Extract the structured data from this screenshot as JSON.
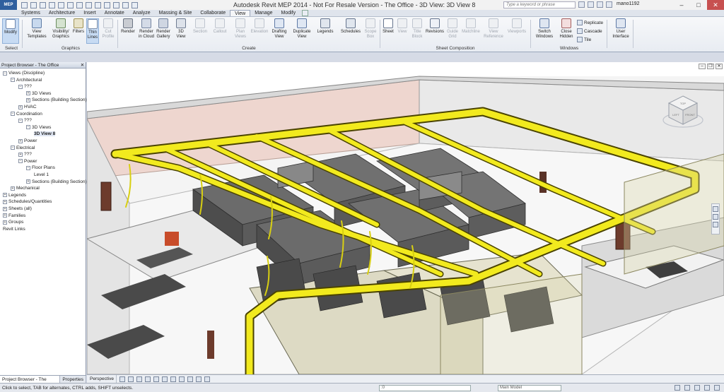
{
  "app": {
    "title": "Autodesk Revit MEP 2014 -  Not For Resale Version -   The Office - 3D View: 3D View 8",
    "app_button": "MEP",
    "search_placeholder": "Type a keyword or phrase",
    "user": "mano1192"
  },
  "tabs": [
    "Systems",
    "Architecture",
    "Insert",
    "Annotate",
    "Analyze",
    "Massing & Site",
    "Collaborate",
    "View",
    "Manage",
    "Modify"
  ],
  "active_tab": "View",
  "ribbon": {
    "modify": "Modify",
    "select_panel": "Select",
    "graphics": {
      "label": "Graphics",
      "view_templates": "View\nTemplates",
      "visibility_graphics": "Visibility/\nGraphics",
      "filters": "Filters",
      "thin_lines": "Thin\nLines",
      "cut_profile": "Cut\nProfile"
    },
    "create": {
      "label": "Create",
      "render": "Render",
      "render_cloud": "Render\nin Cloud",
      "render_gallery": "Render\nGallery",
      "view_3d": "3D\nView",
      "section": "Section",
      "callout": "Callout",
      "plan_views": "Plan\nViews",
      "elevation": "Elevation",
      "drafting_view": "Drafting\nView",
      "duplicate_view": "Duplicate\nView",
      "legends": "Legends",
      "schedules": "Schedules",
      "scope_box": "Scope\nBox"
    },
    "sheet_composition": {
      "label": "Sheet Composition",
      "sheet": "Sheet",
      "view": "View",
      "title_block": "Title\nBlock",
      "revisions": "Revisions",
      "guide_grid": "Guide\nGrid",
      "matchline": "Matchline",
      "view_reference": "View\nReference",
      "viewports": "Viewports"
    },
    "windows": {
      "label": "Windows",
      "switch_windows": "Switch\nWindows",
      "close_hidden": "Close\nHidden",
      "replicate": "Replicate",
      "cascade": "Cascade",
      "tile": "Tile"
    },
    "user_interface": "User\nInterface"
  },
  "project_browser": {
    "title": "Project Browser - The Office",
    "nodes": [
      {
        "label": "Views (Discipline)",
        "level": 0,
        "exp": "-"
      },
      {
        "label": "Architectural",
        "level": 1,
        "exp": "-"
      },
      {
        "label": "???",
        "level": 2,
        "exp": "-"
      },
      {
        "label": "3D Views",
        "level": 3,
        "exp": "+"
      },
      {
        "label": "Sections (Building Section)",
        "level": 3,
        "exp": "+"
      },
      {
        "label": "HVAC",
        "level": 2,
        "exp": "+"
      },
      {
        "label": "Coordination",
        "level": 1,
        "exp": "-"
      },
      {
        "label": "???",
        "level": 2,
        "exp": "-"
      },
      {
        "label": "3D Views",
        "level": 3,
        "exp": "-"
      },
      {
        "label": "3D View 8",
        "level": 4,
        "exp": "",
        "selected": true
      },
      {
        "label": "Power",
        "level": 2,
        "exp": "+"
      },
      {
        "label": "Electrical",
        "level": 1,
        "exp": "-"
      },
      {
        "label": "???",
        "level": 2,
        "exp": "+"
      },
      {
        "label": "Power",
        "level": 2,
        "exp": "-"
      },
      {
        "label": "Floor Plans",
        "level": 3,
        "exp": "-"
      },
      {
        "label": "Level 1",
        "level": 4,
        "exp": ""
      },
      {
        "label": "Sections (Building Section)",
        "level": 3,
        "exp": "+"
      },
      {
        "label": "Mechanical",
        "level": 1,
        "exp": "+"
      },
      {
        "label": "Legends",
        "level": 0,
        "exp": "+"
      },
      {
        "label": "Schedules/Quantities",
        "level": 0,
        "exp": "+"
      },
      {
        "label": "Sheets (all)",
        "level": 0,
        "exp": "+"
      },
      {
        "label": "Families",
        "level": 0,
        "exp": "+"
      },
      {
        "label": "Groups",
        "level": 0,
        "exp": "+"
      },
      {
        "label": "Revit Links",
        "level": 0,
        "exp": ""
      }
    ],
    "tabs": [
      "Project Browser - The Office",
      "Properties"
    ]
  },
  "viewport": {
    "viewcube_labels": {
      "top": "TOP",
      "left": "LEFT",
      "front": "FRONT"
    }
  },
  "view_control": {
    "scale": "Perspective"
  },
  "status": {
    "hint": "Click to select, TAB for alternates, CTRL adds, SHIFT unselects.",
    "workset": ":0",
    "model": "Main Model"
  },
  "colors": {
    "duct": "#f2ea1e",
    "duct_edge": "#4a4300",
    "wall": "#f0f0f0",
    "accent": "#c9dcf2"
  }
}
